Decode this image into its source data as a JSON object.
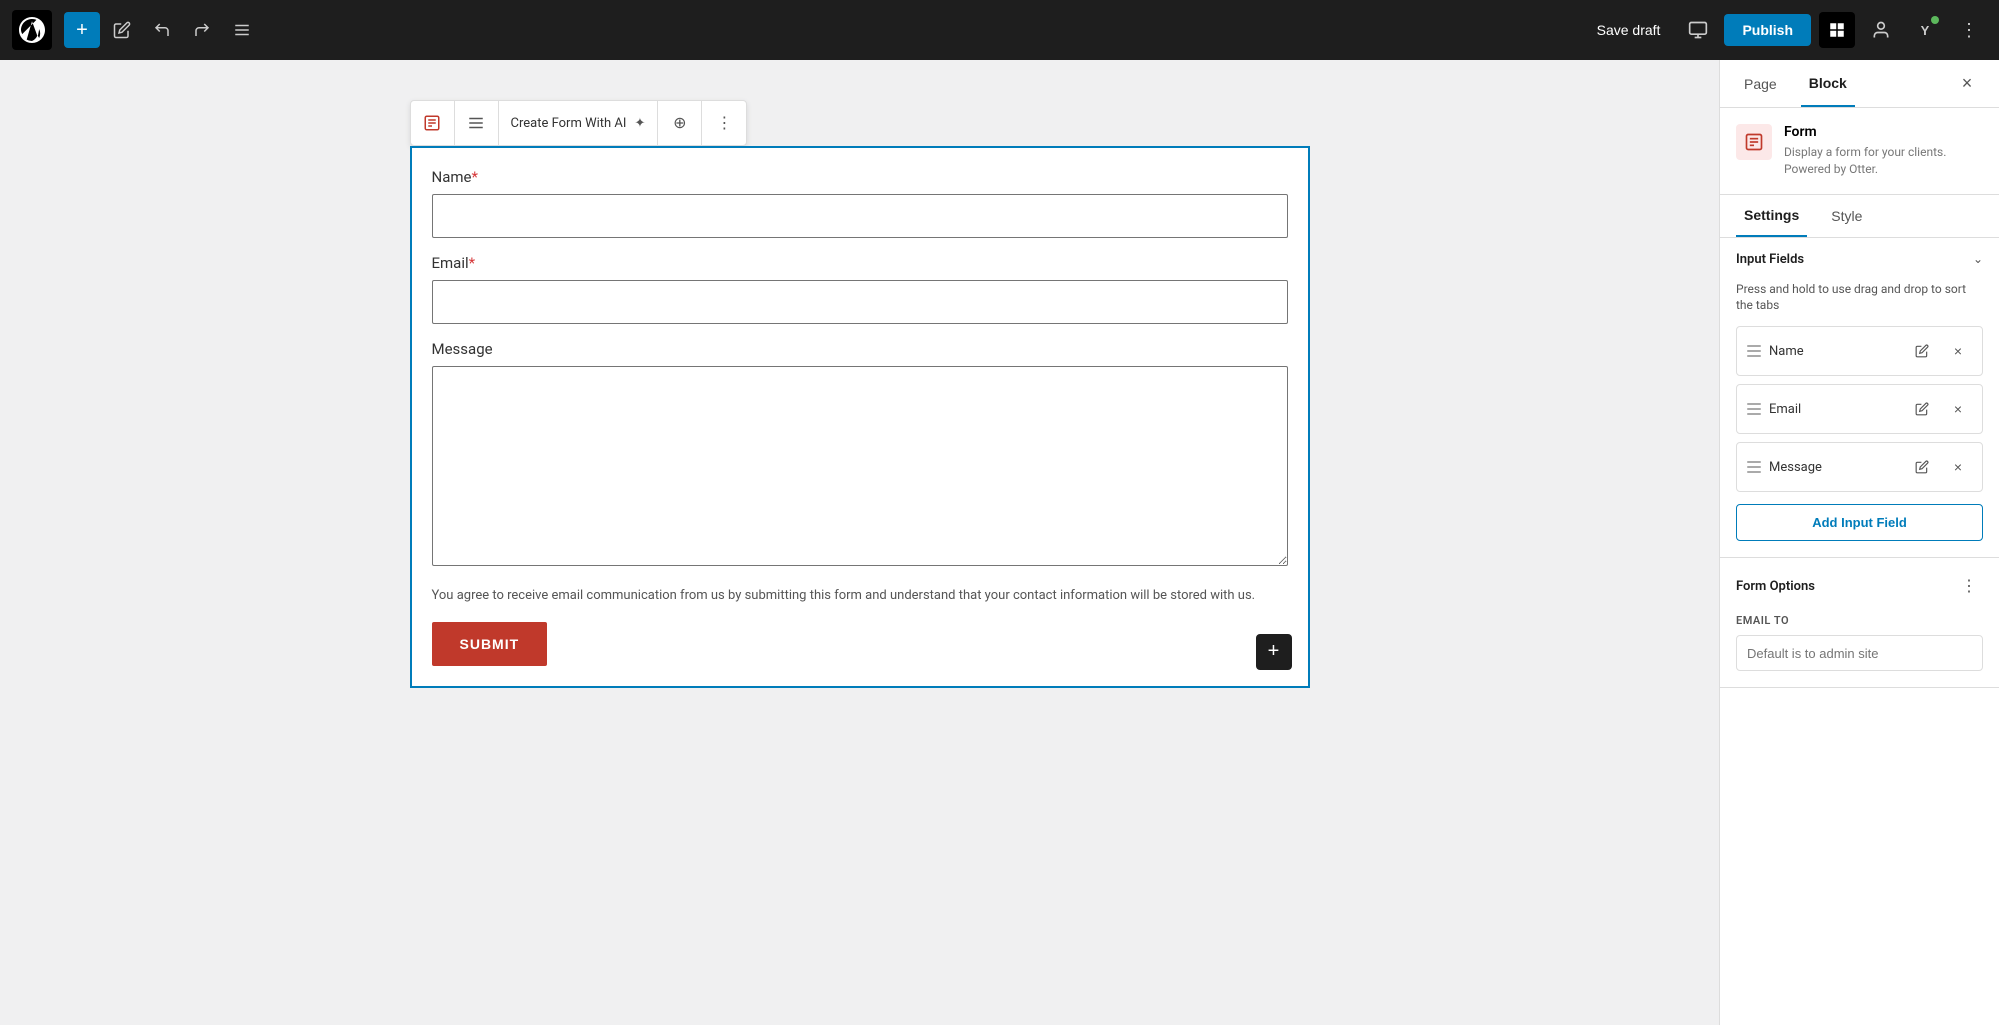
{
  "topbar": {
    "add_label": "+",
    "save_draft_label": "Save draft",
    "publish_label": "Publish"
  },
  "toolbar": {
    "create_form_label": "Create Form With AI",
    "more_options_label": "⋮"
  },
  "form": {
    "name_label": "Name",
    "name_required": true,
    "email_label": "Email",
    "email_required": true,
    "message_label": "Message",
    "consent_text": "You agree to receive email communication from us by submitting this form and understand that your contact information will be stored with us.",
    "submit_label": "SUBMIT"
  },
  "sidebar": {
    "page_tab": "Page",
    "block_tab": "Block",
    "close_label": "×",
    "block_info": {
      "icon": "📋",
      "title": "Form",
      "description": "Display a form for your clients. Powered by Otter."
    },
    "settings_tab": "Settings",
    "style_tab": "Style",
    "input_fields_section": {
      "title": "Input Fields",
      "hint": "Press and hold to use drag and drop to sort the tabs",
      "fields": [
        {
          "id": 1,
          "name": "Name"
        },
        {
          "id": 2,
          "name": "Email"
        },
        {
          "id": 3,
          "name": "Message"
        }
      ],
      "add_button_label": "Add Input Field"
    },
    "form_options_section": {
      "title": "Form Options"
    },
    "email_to": {
      "label": "EMAIL TO",
      "placeholder": "Default is to admin site"
    }
  }
}
